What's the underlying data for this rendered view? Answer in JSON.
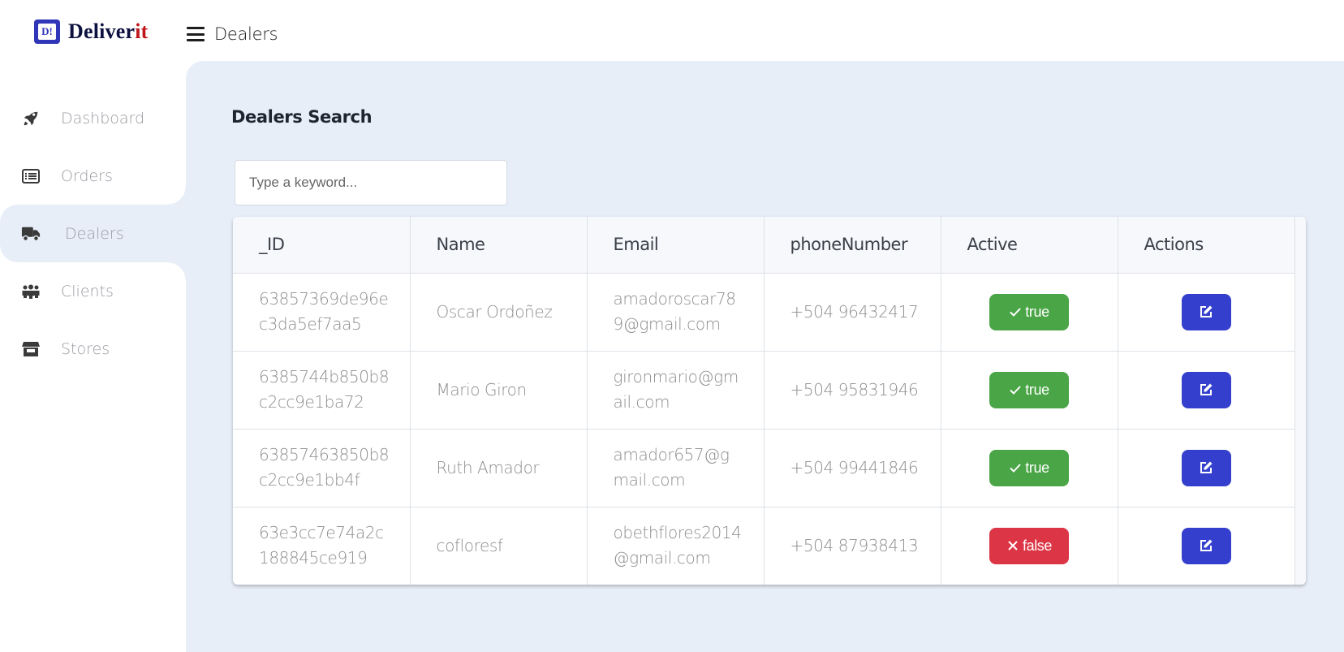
{
  "app": {
    "logo_badge": "D!",
    "logo_name_main": "Deliver",
    "logo_name_accent": "it",
    "brand_color": "#2f36b8",
    "accent_color": "#c0161b"
  },
  "header": {
    "menu_icon": "hamburger-icon",
    "title": "Dealers"
  },
  "sidebar": {
    "items": [
      {
        "label": "Dashboard",
        "icon": "rocket-icon",
        "active": false
      },
      {
        "label": "Orders",
        "icon": "list-icon",
        "active": false
      },
      {
        "label": "Dealers",
        "icon": "truck-icon",
        "active": true
      },
      {
        "label": "Clients",
        "icon": "users-icon",
        "active": false
      },
      {
        "label": "Stores",
        "icon": "store-icon",
        "active": false
      }
    ]
  },
  "main": {
    "section_title": "Dealers Search",
    "search": {
      "placeholder": "Type a keyword...",
      "value": ""
    },
    "table": {
      "columns": [
        "_ID",
        "Name",
        "Email",
        "phoneNumber",
        "Active",
        "Actions"
      ],
      "rows": [
        {
          "id": "63857369de96ec3da5ef7aa5",
          "name": "Oscar Ordoñez",
          "email": "amadoroscar789@gmail.com",
          "phone": "+504 96432417",
          "active": "true"
        },
        {
          "id": "6385744b850b8c2cc9e1ba72",
          "name": "Mario Giron",
          "email": "gironmario@gmail.com",
          "phone": "+504 95831946",
          "active": "true"
        },
        {
          "id": "63857463850b8c2cc9e1bb4f",
          "name": "Ruth Amador",
          "email": "amador657@gmail.com",
          "phone": "+504 99441846",
          "active": "true"
        },
        {
          "id": "63e3cc7e74a2c188845ce919",
          "name": "cofloresf",
          "email": "obethflores2014@gmail.com",
          "phone": "+504 87938413",
          "active": "false"
        }
      ]
    },
    "status_colors": {
      "true": "#4aa546",
      "false": "#dc3545"
    },
    "edit_button_color": "#3440cd",
    "edit_icon": "edit-icon"
  }
}
